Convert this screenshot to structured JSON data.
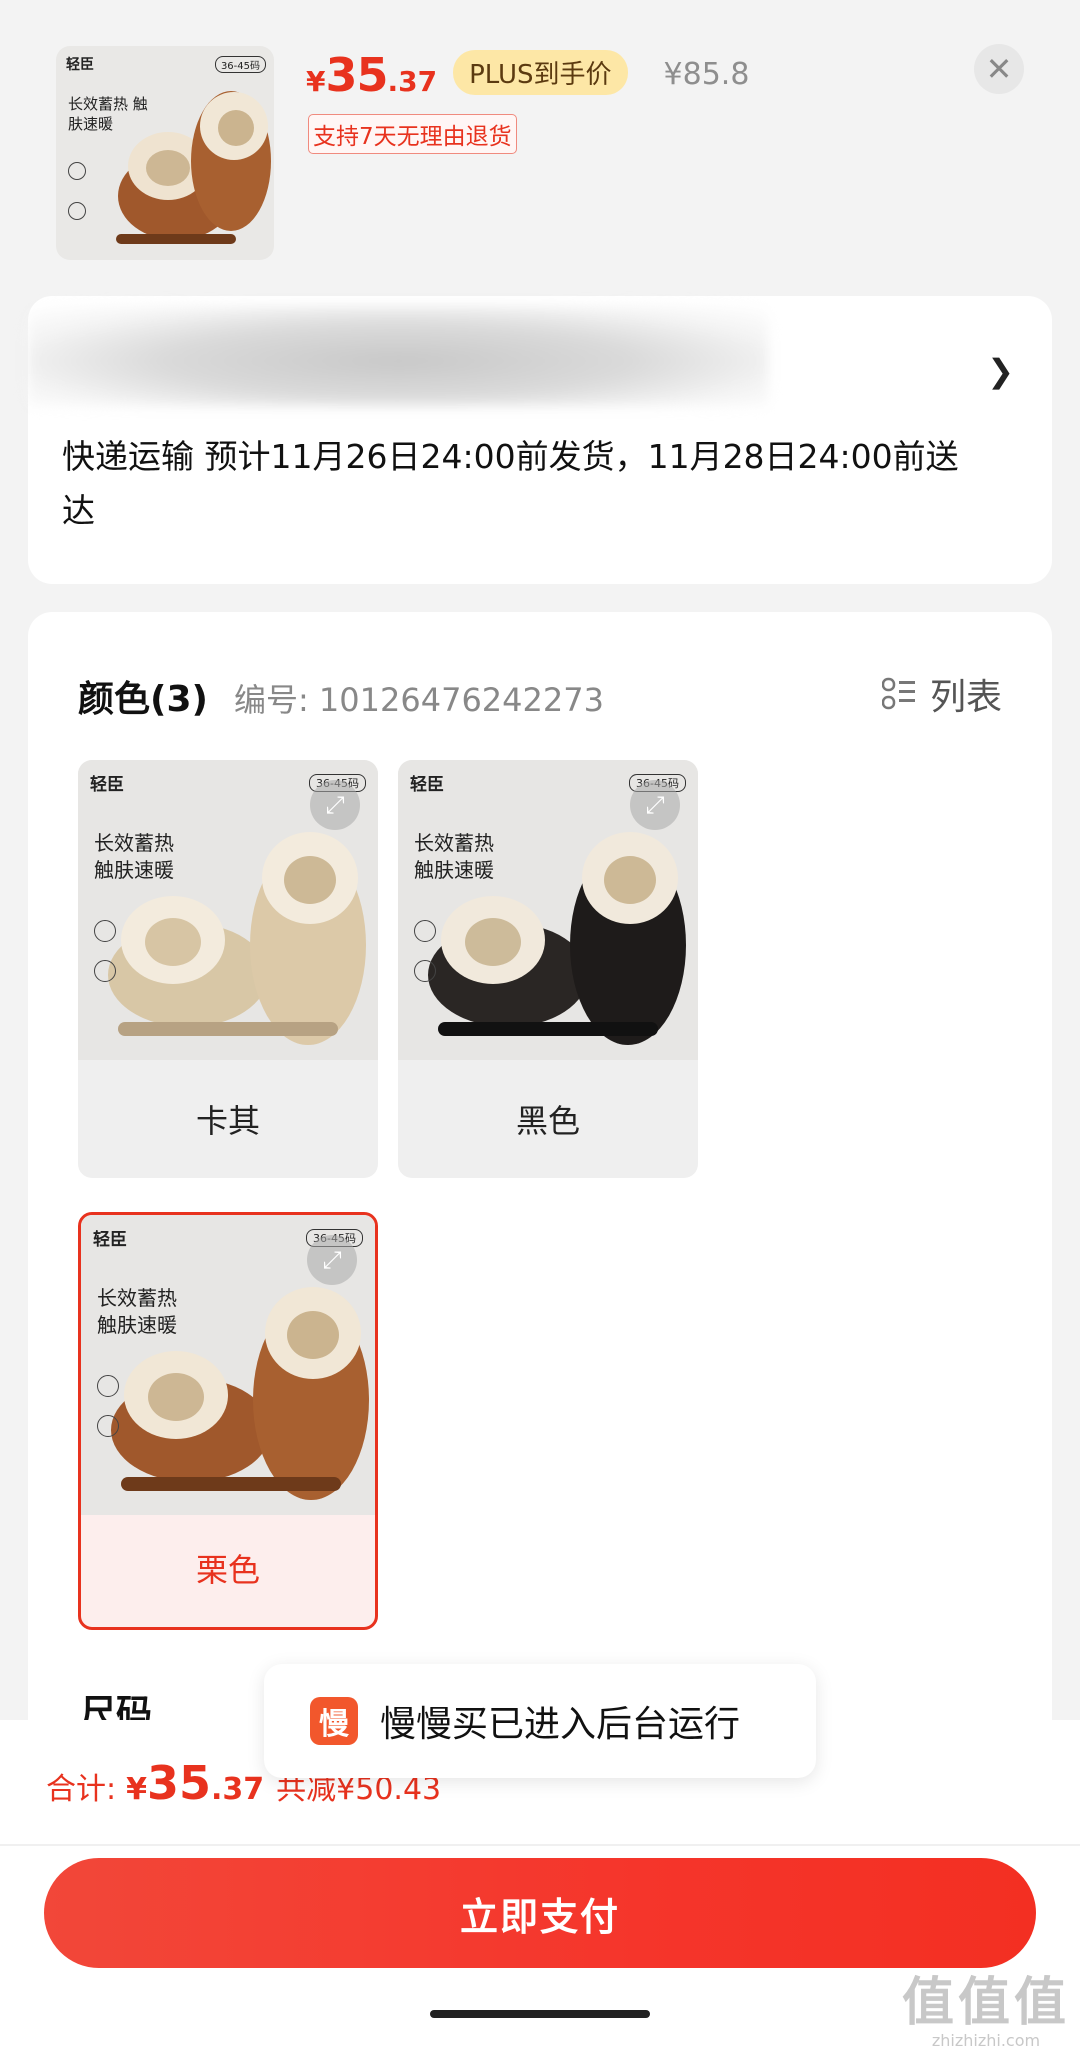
{
  "product": {
    "thumb_brand": "轻臣",
    "thumb_size": "36-45码",
    "thumb_slogan": "长效蓄热 触肤速暖",
    "price_yen": "¥",
    "price_int": "35",
    "price_dec": ".37",
    "plus_label": "PLUS到手价",
    "original_price": "¥85.8",
    "return_policy": "支持7天无理由退货"
  },
  "delivery": {
    "text": "快递运输 预计11月26日24:00前发货，11月28日24:00前送达"
  },
  "sku": {
    "color_title": "颜色(3)",
    "sku_code": "编号: 10126476242273",
    "list_label": "列表",
    "options": [
      {
        "label": "卡其",
        "brand": "轻臣",
        "size": "36-45码",
        "slogan": "长效蓄热 触肤速暖",
        "color": "#d8c7a6",
        "selected": false
      },
      {
        "label": "黑色",
        "brand": "轻臣",
        "size": "36-45码",
        "slogan": "长效蓄热 触肤速暖",
        "color": "#2a2624",
        "selected": false
      },
      {
        "label": "栗色",
        "brand": "轻臣",
        "size": "36-45码",
        "slogan": "长效蓄热 触肤速暖",
        "color": "#a0582c",
        "selected": true
      }
    ],
    "size_title": "尺码"
  },
  "toast": {
    "logo_char": "慢",
    "text": "慢慢买已进入后台运行"
  },
  "footer": {
    "total_label": "合计:",
    "total_yen": "¥",
    "total_int": "35",
    "total_dec": ".37",
    "saving": "共减¥50.43",
    "pay_label": "立即支付"
  },
  "watermark": {
    "main": "值值值",
    "sub": "zhizhizhi.com"
  },
  "colors": {
    "accent": "#e8321e",
    "plus_bg": "#fde7a6",
    "page_bg": "#f3f3f3"
  }
}
